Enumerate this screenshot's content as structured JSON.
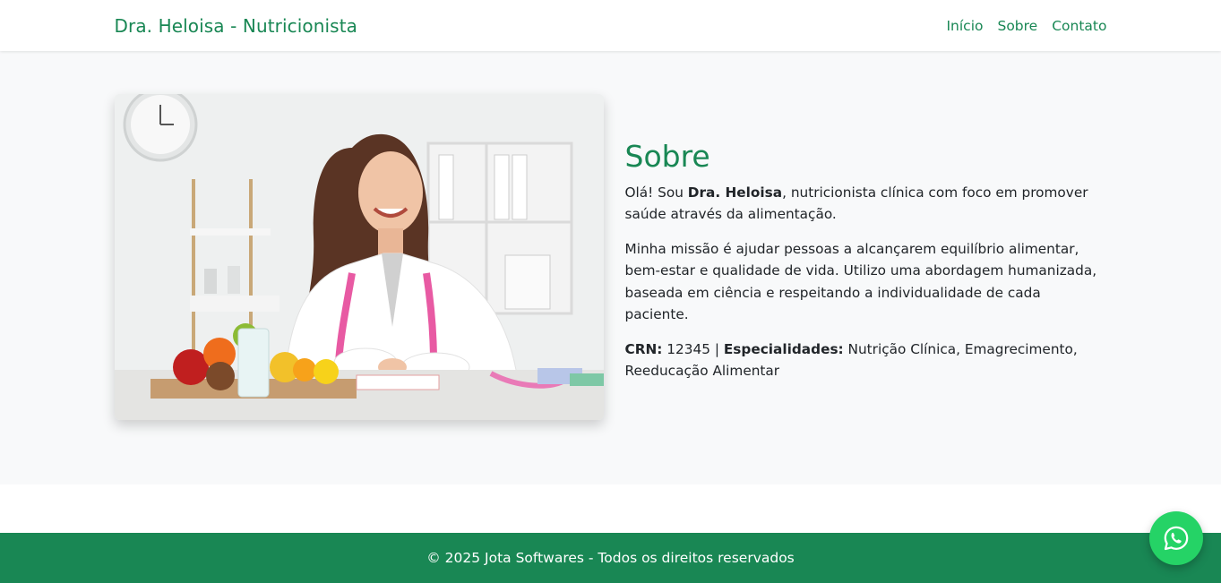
{
  "navbar": {
    "brand": "Dra. Heloisa - Nutricionista",
    "links": [
      "Início",
      "Sobre",
      "Contato"
    ]
  },
  "about": {
    "title": "Sobre",
    "p1_a": "Olá! Sou ",
    "p1_name": "Dra. Heloisa",
    "p1_b": ", nutricionista clínica com foco em promover saúde através da alimentação.",
    "p2": "Minha missão é ajudar pessoas a alcançarem equilíbrio alimentar, bem-estar e qualidade de vida. Utilizo uma abordagem humanizada, baseada em ciência e respeitando a individualidade de cada paciente.",
    "crn_label": "CRN:",
    "crn_value": " 12345 | ",
    "spec_label": "Especialidades:",
    "spec_value": " Nutrição Clínica, Emagrecimento, Reeducação Alimentar",
    "photo_icon": "nutritionist-photo"
  },
  "footer": {
    "text": "© 2025 Jota Softwares - Todos os direitos reservados"
  },
  "whatsapp": {
    "icon": "whatsapp-icon"
  },
  "colors": {
    "brand_green": "#198754",
    "whatsapp_green": "#25d366",
    "section_bg": "#f8f9fa"
  }
}
